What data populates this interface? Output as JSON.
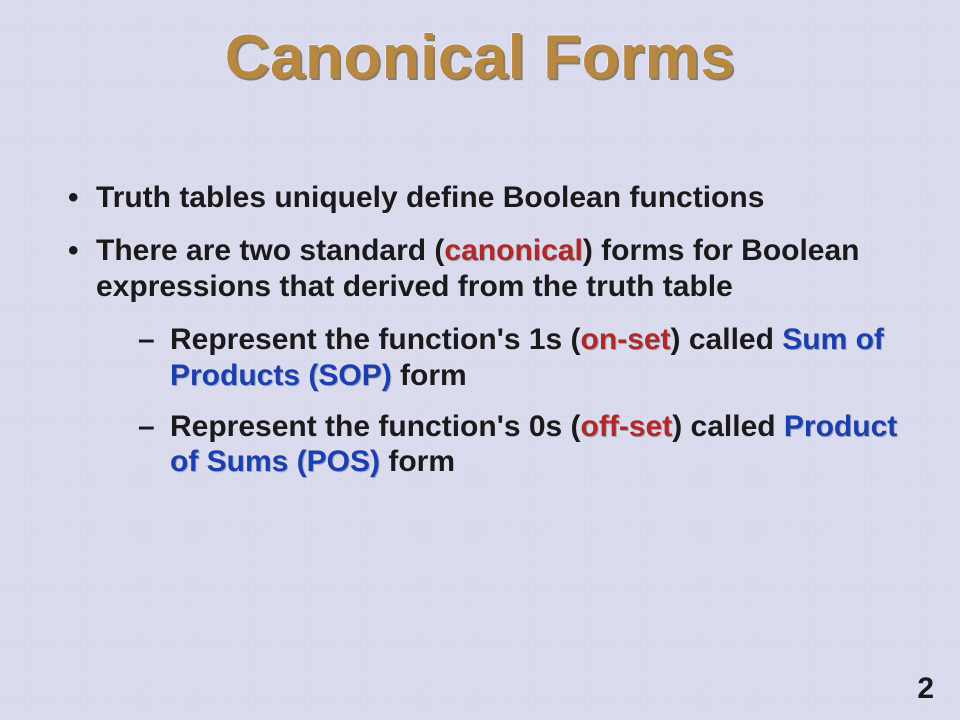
{
  "title": "Canonical Forms",
  "bullet1": "Truth tables uniquely define Boolean functions",
  "bullet2": {
    "pre": "There are two standard (",
    "kw": "canonical",
    "post": ") forms for Boolean expressions that derived from the truth table"
  },
  "sub1": {
    "pre": "Represent the function's 1s (",
    "kw1": "on-set",
    "mid": ") called ",
    "kw2": "Sum of Products (SOP)",
    "post": " form"
  },
  "sub2": {
    "pre": "Represent the function's 0s (",
    "kw1": "off-set",
    "mid": ") called ",
    "kw2": "Product of Sums (POS)",
    "post": " form"
  },
  "page": "2"
}
